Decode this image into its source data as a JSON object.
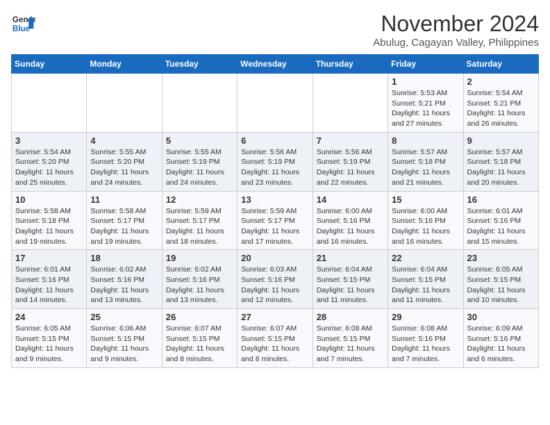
{
  "header": {
    "logo_line1": "General",
    "logo_line2": "Blue",
    "title": "November 2024",
    "subtitle": "Abulug, Cagayan Valley, Philippines"
  },
  "calendar": {
    "days_of_week": [
      "Sunday",
      "Monday",
      "Tuesday",
      "Wednesday",
      "Thursday",
      "Friday",
      "Saturday"
    ],
    "weeks": [
      [
        {
          "day": "",
          "info": ""
        },
        {
          "day": "",
          "info": ""
        },
        {
          "day": "",
          "info": ""
        },
        {
          "day": "",
          "info": ""
        },
        {
          "day": "",
          "info": ""
        },
        {
          "day": "1",
          "info": "Sunrise: 5:53 AM\nSunset: 5:21 PM\nDaylight: 11 hours and 27 minutes."
        },
        {
          "day": "2",
          "info": "Sunrise: 5:54 AM\nSunset: 5:21 PM\nDaylight: 11 hours and 26 minutes."
        }
      ],
      [
        {
          "day": "3",
          "info": "Sunrise: 5:54 AM\nSunset: 5:20 PM\nDaylight: 11 hours and 25 minutes."
        },
        {
          "day": "4",
          "info": "Sunrise: 5:55 AM\nSunset: 5:20 PM\nDaylight: 11 hours and 24 minutes."
        },
        {
          "day": "5",
          "info": "Sunrise: 5:55 AM\nSunset: 5:19 PM\nDaylight: 11 hours and 24 minutes."
        },
        {
          "day": "6",
          "info": "Sunrise: 5:56 AM\nSunset: 5:19 PM\nDaylight: 11 hours and 23 minutes."
        },
        {
          "day": "7",
          "info": "Sunrise: 5:56 AM\nSunset: 5:19 PM\nDaylight: 11 hours and 22 minutes."
        },
        {
          "day": "8",
          "info": "Sunrise: 5:57 AM\nSunset: 5:18 PM\nDaylight: 11 hours and 21 minutes."
        },
        {
          "day": "9",
          "info": "Sunrise: 5:57 AM\nSunset: 5:18 PM\nDaylight: 11 hours and 20 minutes."
        }
      ],
      [
        {
          "day": "10",
          "info": "Sunrise: 5:58 AM\nSunset: 5:18 PM\nDaylight: 11 hours and 19 minutes."
        },
        {
          "day": "11",
          "info": "Sunrise: 5:58 AM\nSunset: 5:17 PM\nDaylight: 11 hours and 19 minutes."
        },
        {
          "day": "12",
          "info": "Sunrise: 5:59 AM\nSunset: 5:17 PM\nDaylight: 11 hours and 18 minutes."
        },
        {
          "day": "13",
          "info": "Sunrise: 5:59 AM\nSunset: 5:17 PM\nDaylight: 11 hours and 17 minutes."
        },
        {
          "day": "14",
          "info": "Sunrise: 6:00 AM\nSunset: 5:16 PM\nDaylight: 11 hours and 16 minutes."
        },
        {
          "day": "15",
          "info": "Sunrise: 6:00 AM\nSunset: 5:16 PM\nDaylight: 11 hours and 16 minutes."
        },
        {
          "day": "16",
          "info": "Sunrise: 6:01 AM\nSunset: 5:16 PM\nDaylight: 11 hours and 15 minutes."
        }
      ],
      [
        {
          "day": "17",
          "info": "Sunrise: 6:01 AM\nSunset: 5:16 PM\nDaylight: 11 hours and 14 minutes."
        },
        {
          "day": "18",
          "info": "Sunrise: 6:02 AM\nSunset: 5:16 PM\nDaylight: 11 hours and 13 minutes."
        },
        {
          "day": "19",
          "info": "Sunrise: 6:02 AM\nSunset: 5:16 PM\nDaylight: 11 hours and 13 minutes."
        },
        {
          "day": "20",
          "info": "Sunrise: 6:03 AM\nSunset: 5:16 PM\nDaylight: 11 hours and 12 minutes."
        },
        {
          "day": "21",
          "info": "Sunrise: 6:04 AM\nSunset: 5:15 PM\nDaylight: 11 hours and 11 minutes."
        },
        {
          "day": "22",
          "info": "Sunrise: 6:04 AM\nSunset: 5:15 PM\nDaylight: 11 hours and 11 minutes."
        },
        {
          "day": "23",
          "info": "Sunrise: 6:05 AM\nSunset: 5:15 PM\nDaylight: 11 hours and 10 minutes."
        }
      ],
      [
        {
          "day": "24",
          "info": "Sunrise: 6:05 AM\nSunset: 5:15 PM\nDaylight: 11 hours and 9 minutes."
        },
        {
          "day": "25",
          "info": "Sunrise: 6:06 AM\nSunset: 5:15 PM\nDaylight: 11 hours and 9 minutes."
        },
        {
          "day": "26",
          "info": "Sunrise: 6:07 AM\nSunset: 5:15 PM\nDaylight: 11 hours and 8 minutes."
        },
        {
          "day": "27",
          "info": "Sunrise: 6:07 AM\nSunset: 5:15 PM\nDaylight: 11 hours and 8 minutes."
        },
        {
          "day": "28",
          "info": "Sunrise: 6:08 AM\nSunset: 5:15 PM\nDaylight: 11 hours and 7 minutes."
        },
        {
          "day": "29",
          "info": "Sunrise: 6:08 AM\nSunset: 5:16 PM\nDaylight: 11 hours and 7 minutes."
        },
        {
          "day": "30",
          "info": "Sunrise: 6:09 AM\nSunset: 5:16 PM\nDaylight: 11 hours and 6 minutes."
        }
      ]
    ]
  }
}
